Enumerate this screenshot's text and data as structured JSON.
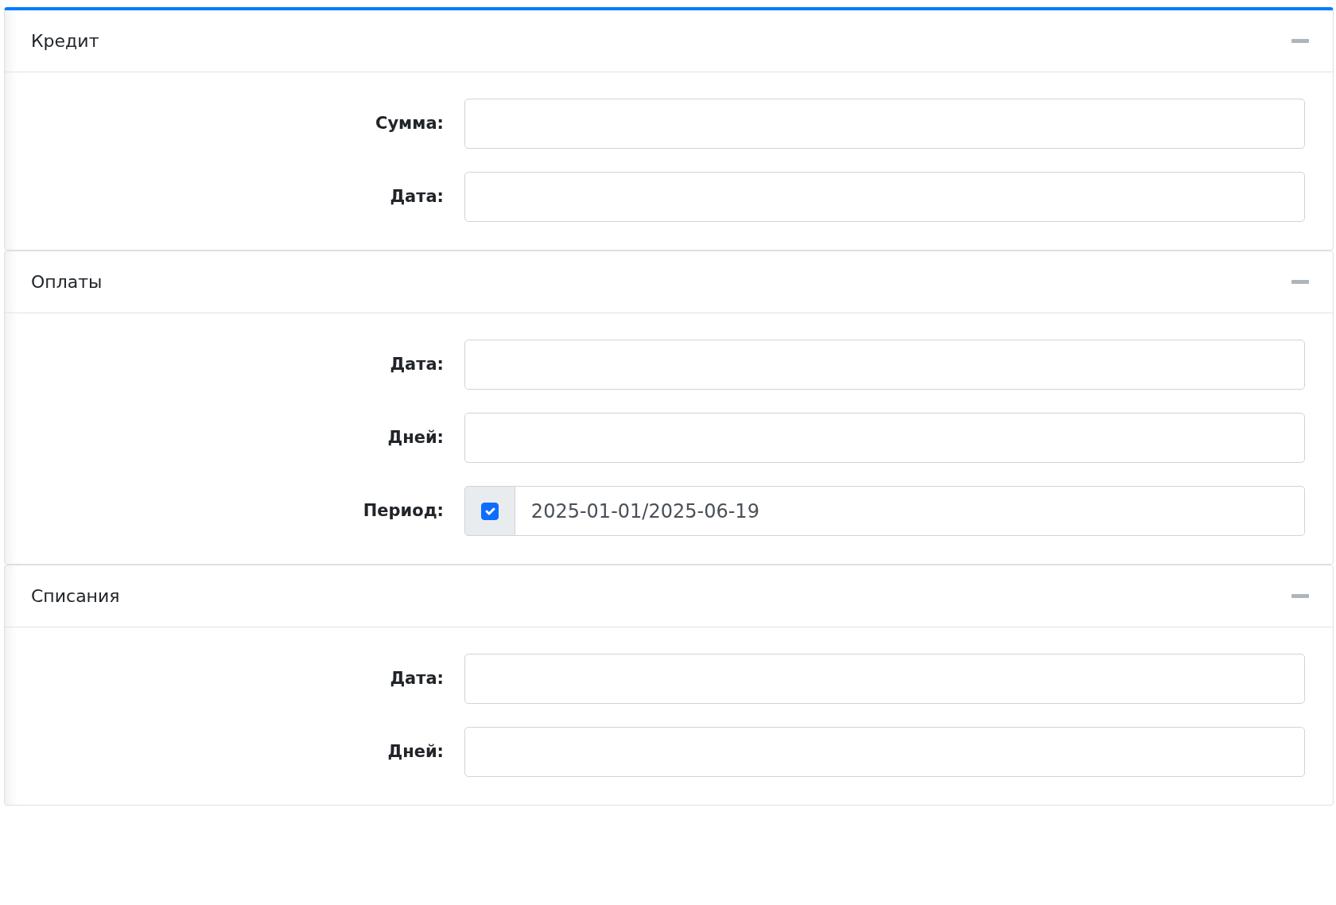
{
  "sections": [
    {
      "title": "Кредит",
      "color": "#007bff",
      "fields": [
        {
          "kind": "text",
          "label": "Сумма:"
        },
        {
          "kind": "text",
          "label": "Дата:"
        }
      ]
    },
    {
      "title": "Оплаты",
      "fields": [
        {
          "kind": "text",
          "label": "Дата:"
        },
        {
          "kind": "text",
          "label": "Дней:"
        },
        {
          "kind": "check-text",
          "label": "Период:",
          "checked": true,
          "value": "2025-01-01/2025-06-19"
        }
      ]
    },
    {
      "title": "Списания",
      "fields": [
        {
          "kind": "text",
          "label": "Дата:"
        },
        {
          "kind": "text",
          "label": "Дней:"
        }
      ]
    }
  ]
}
